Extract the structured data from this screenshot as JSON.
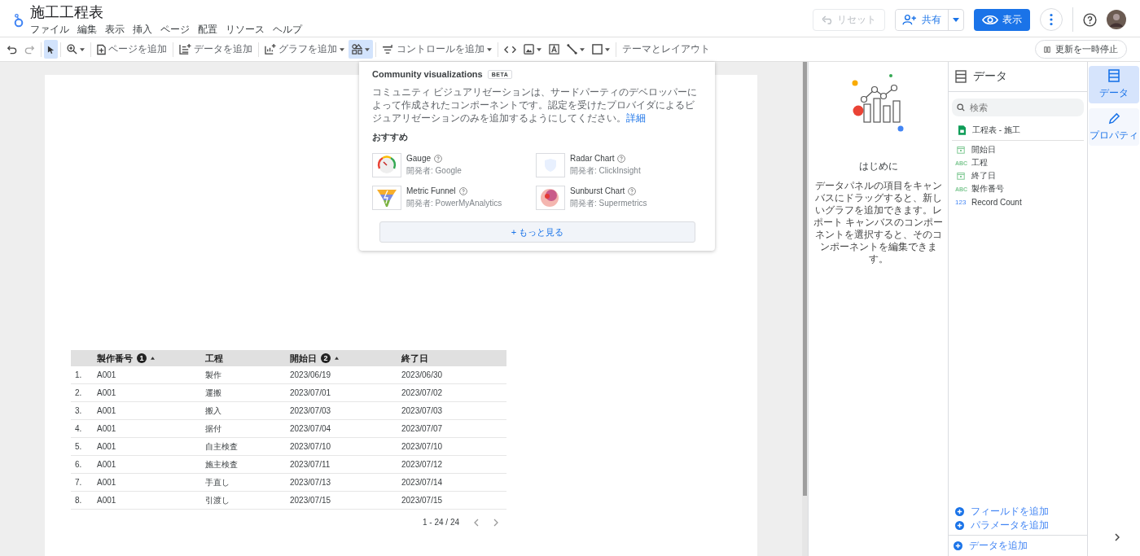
{
  "header": {
    "title": "施工工程表",
    "menu": [
      "ファイル",
      "編集",
      "表示",
      "挿入",
      "ページ",
      "配置",
      "リソース",
      "ヘルプ"
    ],
    "reset": {
      "label": "リセット",
      "disabled": true
    },
    "share": "共有",
    "view": "表示"
  },
  "toolbar": [
    {
      "kind": "undo",
      "selected": false
    },
    {
      "kind": "redo",
      "selected": false
    },
    {
      "kind": "select",
      "selected": true
    },
    {
      "kind": "zoom",
      "caret": true,
      "selected": false
    },
    {
      "kind": "add-page",
      "label": "ページを追加",
      "selected": false
    },
    {
      "kind": "add-data",
      "label": "データを追加",
      "selected": false
    },
    {
      "kind": "add-chart",
      "label": "グラフを追加",
      "caret": true,
      "selected": false
    },
    {
      "kind": "community",
      "caret": true,
      "selected": true
    },
    {
      "kind": "add-control",
      "label": "コントロールを追加",
      "caret": true,
      "selected": false
    },
    {
      "kind": "code",
      "selected": false
    },
    {
      "kind": "image",
      "caret": true,
      "selected": false
    },
    {
      "kind": "text",
      "selected": false
    },
    {
      "kind": "line",
      "caret": true,
      "selected": false
    },
    {
      "kind": "shape",
      "caret": true,
      "selected": false
    },
    {
      "kind": "theme",
      "label": "テーマとレイアウト",
      "selected": false
    }
  ],
  "pause_button": "更新を一時停止",
  "popup": {
    "title": "Community visualizations",
    "badge": "BETA",
    "description": "コミュニティ ビジュアリゼーションは、サードパーティのデベロッパーによって作成されたコンポーネントです。認定を受けたプロバイダによるビジュアリゼーションのみを追加するようにしてください。",
    "link": "詳細",
    "section": "おすすめ",
    "items": [
      {
        "kind": "gauge",
        "name": "Gauge",
        "developer": "開発者: Google"
      },
      {
        "kind": "radar",
        "name": "Radar Chart",
        "developer": "開発者: ClickInsight"
      },
      {
        "kind": "funnel",
        "name": "Metric Funnel",
        "developer": "開発者: PowerMyAnalytics"
      },
      {
        "kind": "sunburst",
        "name": "Sunburst Chart",
        "developer": "開発者: Supermetrics"
      }
    ],
    "more": "+ もっと見る"
  },
  "table": {
    "columns": [
      {
        "label": "製作番号",
        "info": "1",
        "sorted": true
      },
      {
        "label": "工程",
        "sorted": false
      },
      {
        "label": "開始日",
        "info": "2",
        "sorted": true
      },
      {
        "label": "終了日",
        "sorted": false
      }
    ],
    "rows": [
      {
        "index": "1.",
        "cells": [
          "A001",
          "製作",
          "2023/06/19",
          "2023/06/30"
        ]
      },
      {
        "index": "2.",
        "cells": [
          "A001",
          "運搬",
          "2023/07/01",
          "2023/07/02"
        ]
      },
      {
        "index": "3.",
        "cells": [
          "A001",
          "搬入",
          "2023/07/03",
          "2023/07/03"
        ]
      },
      {
        "index": "4.",
        "cells": [
          "A001",
          "据付",
          "2023/07/04",
          "2023/07/07"
        ]
      },
      {
        "index": "5.",
        "cells": [
          "A001",
          "自主検査",
          "2023/07/10",
          "2023/07/10"
        ]
      },
      {
        "index": "6.",
        "cells": [
          "A001",
          "施主検査",
          "2023/07/11",
          "2023/07/12"
        ]
      },
      {
        "index": "7.",
        "cells": [
          "A001",
          "手直し",
          "2023/07/13",
          "2023/07/14"
        ]
      },
      {
        "index": "8.",
        "cells": [
          "A001",
          "引渡し",
          "2023/07/15",
          "2023/07/15"
        ]
      }
    ],
    "pagination": "1 - 24 / 24"
  },
  "getting_started": {
    "title": "はじめに",
    "text": "データパネルの項目をキャンバスにドラッグすると、新しいグラフを追加できます。レポート キャンバスのコンポーネントを選択すると、そのコンポーネントを編集できます。"
  },
  "data_panel": {
    "title": "データ",
    "search_placeholder": "検索",
    "source": "工程表 - 施工",
    "fields": [
      {
        "kind": "date",
        "name": "開始日"
      },
      {
        "kind": "text",
        "type_label": "ABC",
        "name": "工程"
      },
      {
        "kind": "date",
        "name": "終了日"
      },
      {
        "kind": "text",
        "type_label": "ABC",
        "name": "製作番号"
      },
      {
        "kind": "number",
        "type_label": "123",
        "name": "Record Count"
      }
    ],
    "actions": [
      "フィールドを追加",
      "パラメータを追加"
    ],
    "add_data": "データを追加"
  },
  "rail": [
    {
      "kind": "data",
      "label": "データ",
      "selected": true
    },
    {
      "kind": "properties",
      "label": "プロパティ",
      "selected": false
    }
  ]
}
